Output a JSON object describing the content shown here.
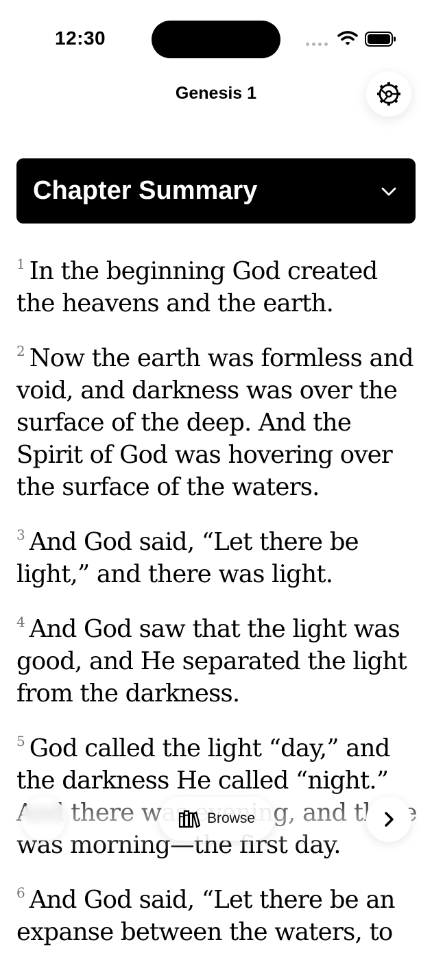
{
  "status_bar": {
    "time": "12:30"
  },
  "header": {
    "title": "Genesis 1",
    "settings_icon": "gear-icon"
  },
  "summary": {
    "title": "Chapter Summary",
    "chevron_icon": "chevron-down-icon"
  },
  "verses": [
    {
      "num": "1",
      "text": "In the beginning God created the heavens and the earth."
    },
    {
      "num": "2",
      "text": "Now the earth was formless and void, and darkness was over the surface of the deep. And the Spirit of God was hovering over the surface of the waters."
    },
    {
      "num": "3",
      "text": "And God said, “Let there be light,” and there was light."
    },
    {
      "num": "4",
      "text": "And God saw that the light was good, and He separated the light from the darkness."
    },
    {
      "num": "5",
      "text": "God called the light “day,” and the darkness He called “night.” And there was evening, and there was morning—the first day."
    },
    {
      "num": "6",
      "text": "And God said, “Let there be an expanse between the waters, to"
    }
  ],
  "bottom_bar": {
    "browse_label": "Browse",
    "browse_icon": "books-icon",
    "next_icon": "chevron-right-icon",
    "prev_icon": "chevron-left-icon"
  }
}
